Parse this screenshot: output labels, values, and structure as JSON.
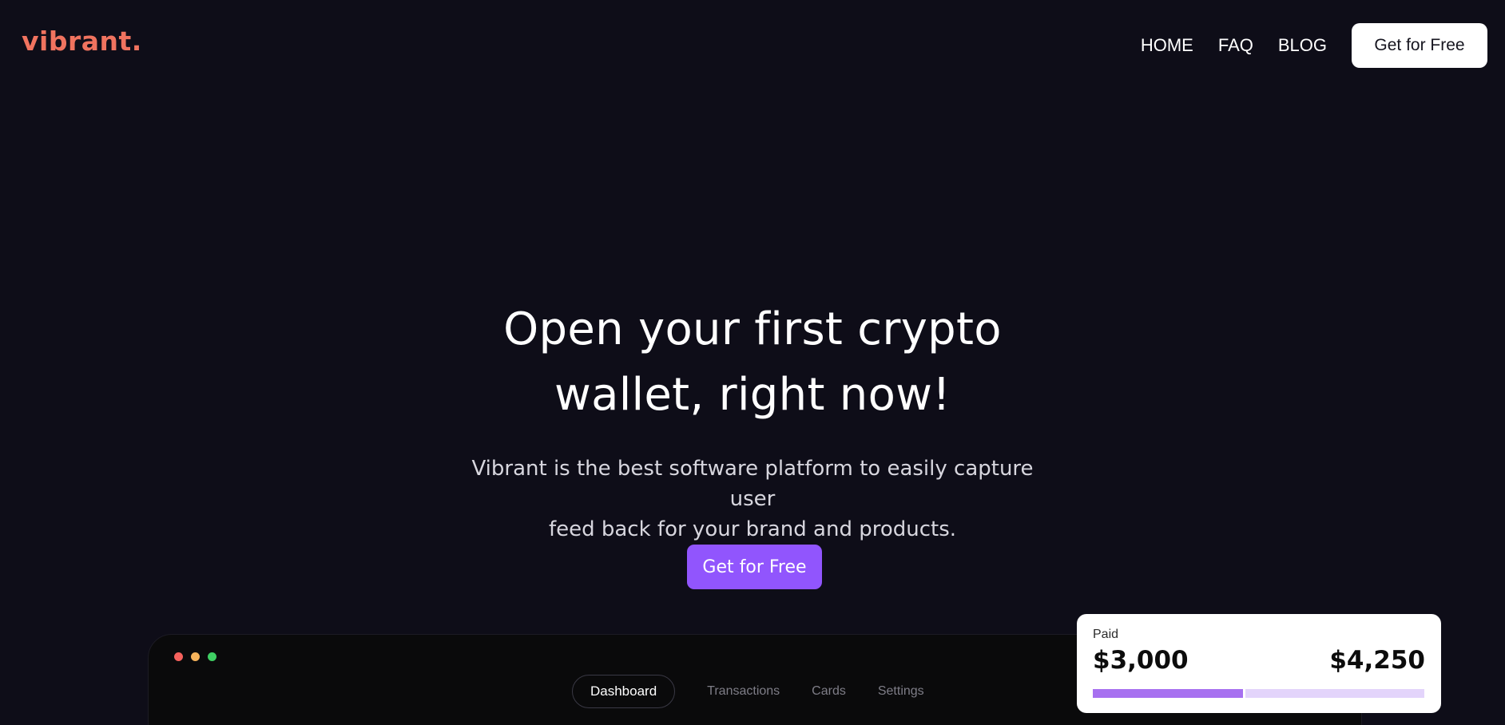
{
  "header": {
    "logo": "vibrant.",
    "nav": [
      {
        "label": "HOME"
      },
      {
        "label": "FAQ"
      },
      {
        "label": "BLOG"
      }
    ],
    "cta_label": "Get for Free"
  },
  "hero": {
    "title_line1": "Open your first crypto",
    "title_line2": "wallet, right now!",
    "subtitle_line1": "Vibrant is the best software platform to easily capture user",
    "subtitle_line2": "feed back for your brand and products.",
    "cta_label": "Get for Free"
  },
  "app_preview": {
    "window_dots": [
      "#f5615c",
      "#f6b35b",
      "#3fcf63"
    ],
    "tabs": [
      {
        "label": "Dashboard",
        "active": true
      },
      {
        "label": "Transactions",
        "active": false
      },
      {
        "label": "Cards",
        "active": false
      },
      {
        "label": "Settings",
        "active": false
      }
    ]
  },
  "paid_card": {
    "label": "Paid",
    "paid_amount": "$3,000",
    "total_amount": "$4,250",
    "progress_fraction": 0.46
  },
  "colors": {
    "background": "#0e0d18",
    "brand": "#f0735f",
    "accent": "#9155fd",
    "progress_fill": "#a770f0",
    "progress_track": "#e3d4fb"
  }
}
